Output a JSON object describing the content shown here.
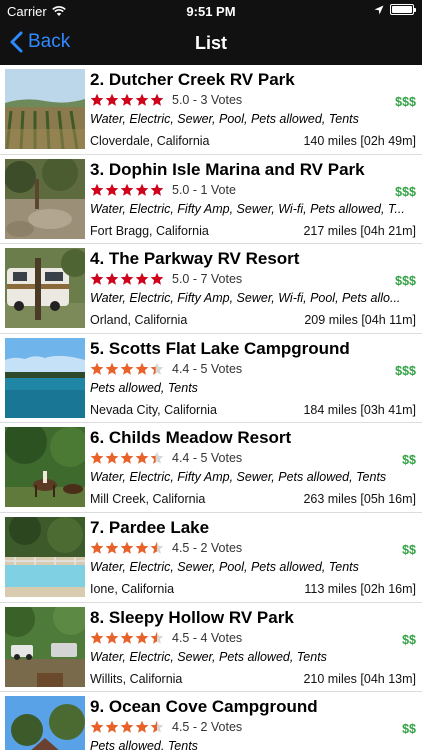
{
  "status_bar": {
    "carrier": "Carrier",
    "time": "9:51 PM"
  },
  "nav": {
    "back_label": "Back",
    "title": "List"
  },
  "colors": {
    "nav_bg": "#111111",
    "accent": "#2e8bff",
    "price_green": "#35a347",
    "star_red": "#d0021b",
    "star_orange": "#e8622a"
  },
  "items": [
    {
      "title": "2. Dutcher Creek RV Park",
      "rating": 5.0,
      "star_color": "red",
      "score_text": "5.0 - 3 Votes",
      "price": "$$$",
      "amenities": "Water, Electric, Sewer, Pool, Pets allowed, Tents",
      "location": "Cloverdale, California",
      "distance": "140 miles [02h 49m]"
    },
    {
      "title": "3. Dophin Isle Marina and RV Park",
      "rating": 5.0,
      "star_color": "red",
      "score_text": "5.0 - 1 Vote",
      "price": "$$$",
      "amenities": "Water, Electric, Fifty Amp, Sewer, Wi-fi, Pets allowed, T...",
      "location": "Fort Bragg, California",
      "distance": "217 miles [04h 21m]"
    },
    {
      "title": "4. The Parkway RV Resort",
      "rating": 5.0,
      "star_color": "red",
      "score_text": "5.0 - 7 Votes",
      "price": "$$$",
      "amenities": "Water, Electric, Fifty Amp, Sewer, Wi-fi, Pool, Pets allo...",
      "location": "Orland, California",
      "distance": "209 miles [04h 11m]"
    },
    {
      "title": "5. Scotts Flat Lake Campground",
      "rating": 4.4,
      "star_color": "orange",
      "score_text": "4.4 - 5 Votes",
      "price": "$$$",
      "amenities": "Pets allowed, Tents",
      "location": "Nevada City, California",
      "distance": "184 miles [03h 41m]"
    },
    {
      "title": "6. Childs Meadow Resort",
      "rating": 4.4,
      "star_color": "orange",
      "score_text": "4.4 - 5 Votes",
      "price": "$$",
      "amenities": "Water, Electric, Fifty Amp, Sewer, Pets allowed, Tents",
      "location": "Mill Creek, California",
      "distance": "263 miles [05h 16m]"
    },
    {
      "title": "7. Pardee Lake",
      "rating": 4.5,
      "star_color": "orange",
      "score_text": "4.5 - 2 Votes",
      "price": "$$",
      "amenities": "Water, Electric, Sewer, Pool, Pets allowed, Tents",
      "location": "Ione, California",
      "distance": "113 miles [02h 16m]"
    },
    {
      "title": "8. Sleepy Hollow RV Park",
      "rating": 4.5,
      "star_color": "orange",
      "score_text": "4.5 - 4 Votes",
      "price": "$$",
      "amenities": "Water, Electric, Sewer, Pets allowed, Tents",
      "location": "Willits, California",
      "distance": "210 miles [04h 13m]"
    },
    {
      "title": "9. Ocean Cove Campground",
      "rating": 4.5,
      "star_color": "orange",
      "score_text": "4.5 - 2 Votes",
      "price": "$$",
      "amenities": "Pets allowed, Tents",
      "location": "",
      "distance": ""
    }
  ]
}
